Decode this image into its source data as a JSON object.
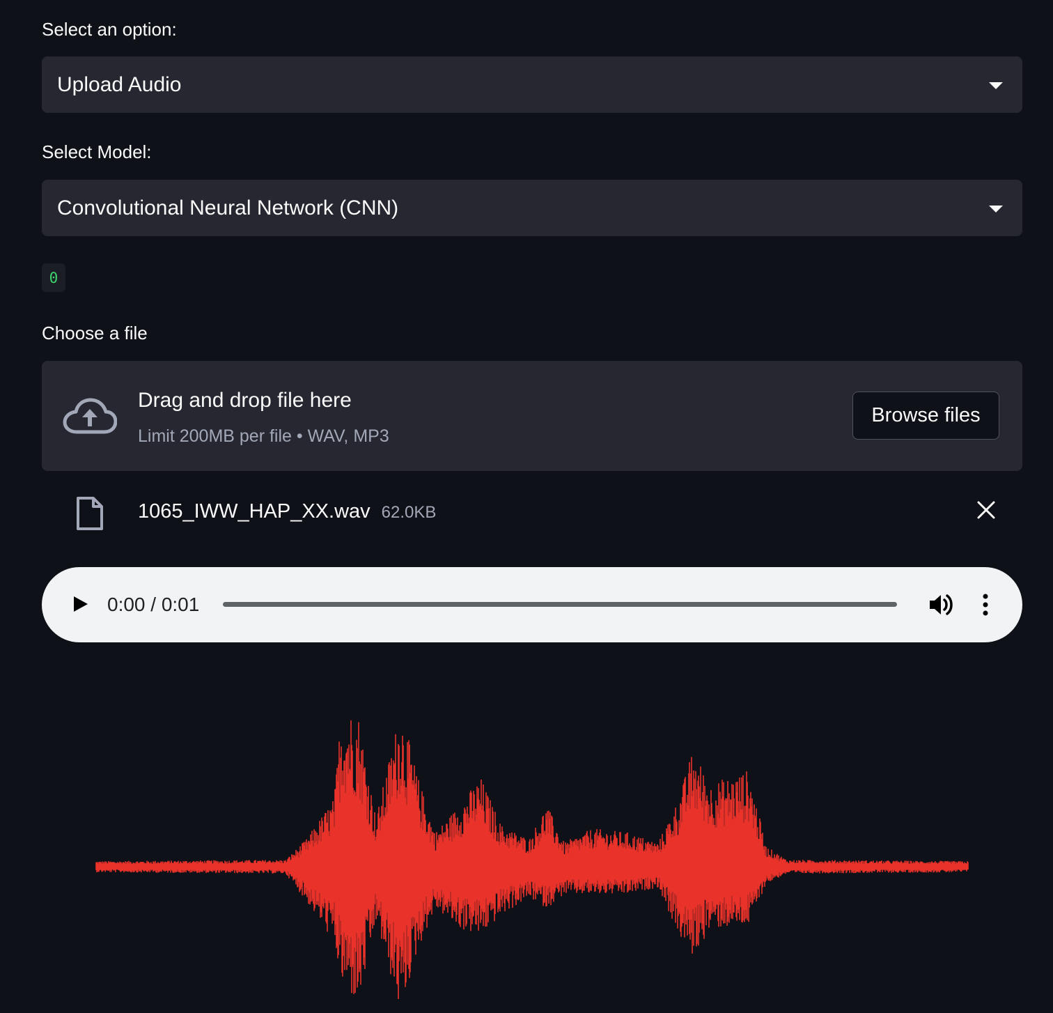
{
  "option_select": {
    "label": "Select an option:",
    "value": "Upload Audio"
  },
  "model_select": {
    "label": "Select Model:",
    "value": "Convolutional Neural Network (CNN)"
  },
  "code_output": "0",
  "uploader": {
    "label": "Choose a file",
    "drop_text": "Drag and drop file here",
    "limit_text": "Limit 200MB per file • WAV, MP3",
    "browse_label": "Browse files"
  },
  "uploaded_file": {
    "name": "1065_IWW_HAP_XX.wav",
    "size": "62.0KB"
  },
  "audio_player": {
    "time": "0:00 / 0:01",
    "progress": 0
  },
  "waveform": {
    "color": "#e8322a"
  },
  "colors": {
    "background": "#0e1117",
    "widget": "#262730",
    "text": "#fafafa",
    "muted": "#a3a8b8",
    "code_green": "#3dd56d"
  },
  "icons": {
    "select_arrow": "chevron-down-icon",
    "upload": "cloud-upload-icon",
    "file": "file-icon",
    "remove": "close-icon",
    "play": "play-icon",
    "volume": "volume-icon",
    "more": "more-vertical-icon"
  }
}
